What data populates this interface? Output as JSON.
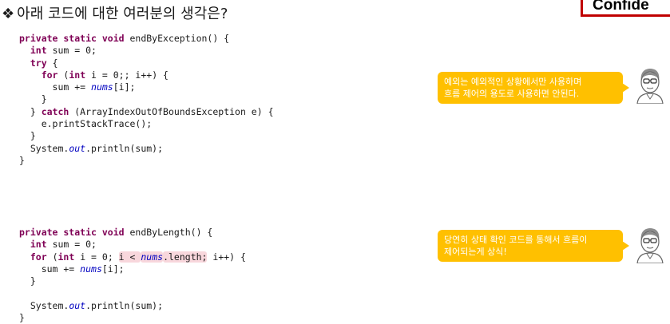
{
  "heading": {
    "bullet": "❖",
    "text": "아래 코드에 대한 여러분의 생각은?"
  },
  "stamp": {
    "text": "Confide"
  },
  "code_blocks": [
    {
      "lines": [
        [
          {
            "t": "private static void ",
            "c": "kw"
          },
          {
            "t": "endByException() {"
          }
        ],
        [
          {
            "t": "  "
          },
          {
            "t": "int",
            "c": "kw"
          },
          {
            "t": " sum = 0;"
          }
        ],
        [
          {
            "t": "  "
          },
          {
            "t": "try",
            "c": "kw"
          },
          {
            "t": " {"
          }
        ],
        [
          {
            "t": "    "
          },
          {
            "t": "for",
            "c": "kw"
          },
          {
            "t": " ("
          },
          {
            "t": "int",
            "c": "kw"
          },
          {
            "t": " i = 0;; i++) {"
          }
        ],
        [
          {
            "t": "      sum += "
          },
          {
            "t": "nums",
            "c": "fld"
          },
          {
            "t": "[i];"
          }
        ],
        [
          {
            "t": "    }"
          }
        ],
        [
          {
            "t": "  } "
          },
          {
            "t": "catch",
            "c": "kw"
          },
          {
            "t": " (ArrayIndexOutOfBoundsException e) {"
          }
        ],
        [
          {
            "t": "    e.printStackTrace();"
          }
        ],
        [
          {
            "t": "  }"
          }
        ],
        [
          {
            "t": "  System."
          },
          {
            "t": "out",
            "c": "fld"
          },
          {
            "t": ".println(sum);"
          }
        ],
        [
          {
            "t": "}"
          }
        ]
      ]
    },
    {
      "lines": [
        [
          {
            "t": "private static void ",
            "c": "kw"
          },
          {
            "t": "endByLength() {"
          }
        ],
        [
          {
            "t": "  "
          },
          {
            "t": "int",
            "c": "kw"
          },
          {
            "t": " sum = 0;"
          }
        ],
        [
          {
            "t": "  "
          },
          {
            "t": "for",
            "c": "kw"
          },
          {
            "t": " ("
          },
          {
            "t": "int",
            "c": "kw"
          },
          {
            "t": " i = 0; "
          },
          {
            "t": "i < ",
            "c": "hl"
          },
          {
            "t": "nums",
            "c": "hl fld"
          },
          {
            "t": ".length;",
            "c": "hl"
          },
          {
            "t": " i++) {"
          }
        ],
        [
          {
            "t": "    sum += "
          },
          {
            "t": "nums",
            "c": "fld"
          },
          {
            "t": "[i];"
          }
        ],
        [
          {
            "t": "  }"
          }
        ],
        [
          {
            "t": ""
          }
        ],
        [
          {
            "t": "  System."
          },
          {
            "t": "out",
            "c": "fld"
          },
          {
            "t": ".println(sum);"
          }
        ],
        [
          {
            "t": "}"
          }
        ]
      ]
    }
  ],
  "comments": {
    "first": {
      "line1": "예외는 예외적인 상황에서만 사용하며",
      "line2": "흐름 제어의 용도로 사용하면 안된다."
    },
    "second": {
      "line1": "당연히 상태 확인 코드를 통해서 흐름이",
      "line2": "제어되는게 상식!"
    }
  },
  "colors": {
    "bubble": "#ffc000",
    "keyword": "#7f0055",
    "field": "#0000c0",
    "highlight": "#f8d7dc",
    "stamp_border": "#c00000"
  },
  "icons": [
    "person-with-glasses-icon",
    "person-with-glasses-icon"
  ]
}
